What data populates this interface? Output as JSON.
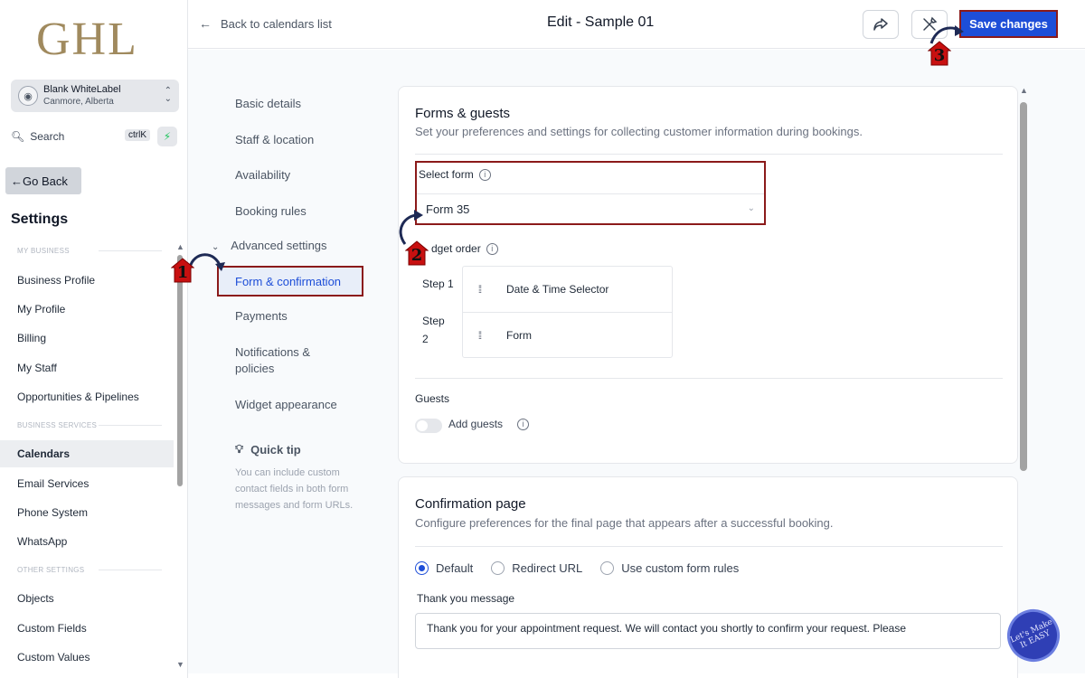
{
  "sidebar": {
    "logo": "GHL",
    "account": {
      "name": "Blank WhiteLabel",
      "location": "Canmore, Alberta"
    },
    "search": {
      "label": "Search",
      "shortcut": "ctrlK"
    },
    "go_back": "Go Back",
    "title": "Settings",
    "sections": [
      {
        "heading": "MY BUSINESS",
        "items": [
          "Business Profile",
          "My Profile",
          "Billing",
          "My Staff",
          "Opportunities & Pipelines"
        ]
      },
      {
        "heading": "BUSINESS SERVICES",
        "items": [
          "Calendars",
          "Email Services",
          "Phone System",
          "WhatsApp"
        ]
      },
      {
        "heading": "OTHER SETTINGS",
        "items": [
          "Objects",
          "Custom Fields",
          "Custom Values"
        ]
      }
    ],
    "active_item": "Calendars"
  },
  "header": {
    "back_label": "Back to calendars list",
    "title": "Edit - Sample 01",
    "save_label": "Save changes"
  },
  "subnav": {
    "items": [
      "Basic details",
      "Staff & location",
      "Availability",
      "Booking rules"
    ],
    "advanced_label": "Advanced settings",
    "active": "Form & confirmation",
    "items_after": [
      "Payments",
      "Notifications & policies",
      "Widget appearance"
    ],
    "tip_title": "Quick tip",
    "tip_text": "You can include custom contact fields in both form messages and form URLs."
  },
  "forms_card": {
    "title": "Forms & guests",
    "subtitle": "Set your preferences and settings for collecting customer information during bookings.",
    "select_label": "Select form",
    "select_value": "Form 35",
    "widget_order_label": "Widget order",
    "widget_order_label_visible": "dget order",
    "steps": [
      {
        "label": "Step 1",
        "item": "Date & Time Selector"
      },
      {
        "label": "Step 2",
        "item": "Form"
      }
    ],
    "guests_title": "Guests",
    "add_guests_label": "Add guests",
    "add_guests_on": false
  },
  "confirmation_card": {
    "title": "Confirmation page",
    "subtitle": "Configure preferences for the final page that appears after a successful booking.",
    "options": [
      "Default",
      "Redirect URL",
      "Use custom form rules"
    ],
    "selected_option": "Default",
    "thank_you_label": "Thank you message",
    "thank_you_value": "Thank you for your appointment request. We will contact you shortly to confirm your request. Please"
  },
  "annotations": [
    "1",
    "2",
    "3"
  ],
  "badge_text": "Let's Make It EASY",
  "colors": {
    "primary": "#1d4ed8",
    "highlight": "#8b1a1a",
    "annotation": "#c81010"
  }
}
